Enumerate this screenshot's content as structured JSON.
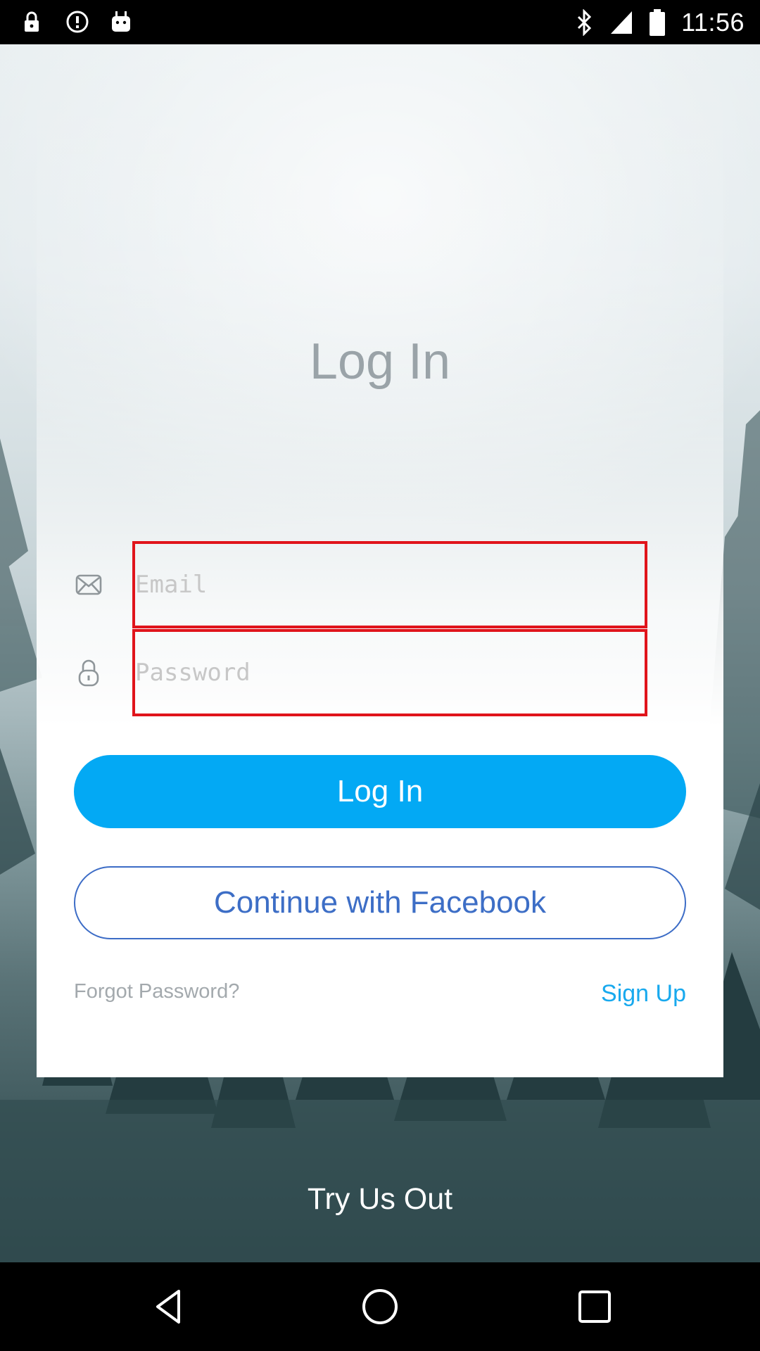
{
  "status_bar": {
    "time": "11:56",
    "left_icons": [
      "lock-icon",
      "alert-circle-icon",
      "android-icon"
    ],
    "right_icons": [
      "bluetooth-icon",
      "signal-icon",
      "battery-icon"
    ]
  },
  "login": {
    "title": "Log In",
    "email_placeholder": "Email",
    "password_placeholder": "Password",
    "login_button": "Log In",
    "facebook_button": "Continue with Facebook",
    "forgot_password": "Forgot Password?",
    "sign_up": "Sign Up",
    "try_us_out": "Try Us Out"
  },
  "nav_bar": {
    "buttons": [
      "back-icon",
      "home-icon",
      "recents-icon"
    ]
  },
  "colors": {
    "accent": "#03a9f4",
    "facebook_text": "#3d6ec6",
    "field_highlight": "#e0141b",
    "link": "#18a9ee",
    "muted_text": "#a3a9ad"
  }
}
